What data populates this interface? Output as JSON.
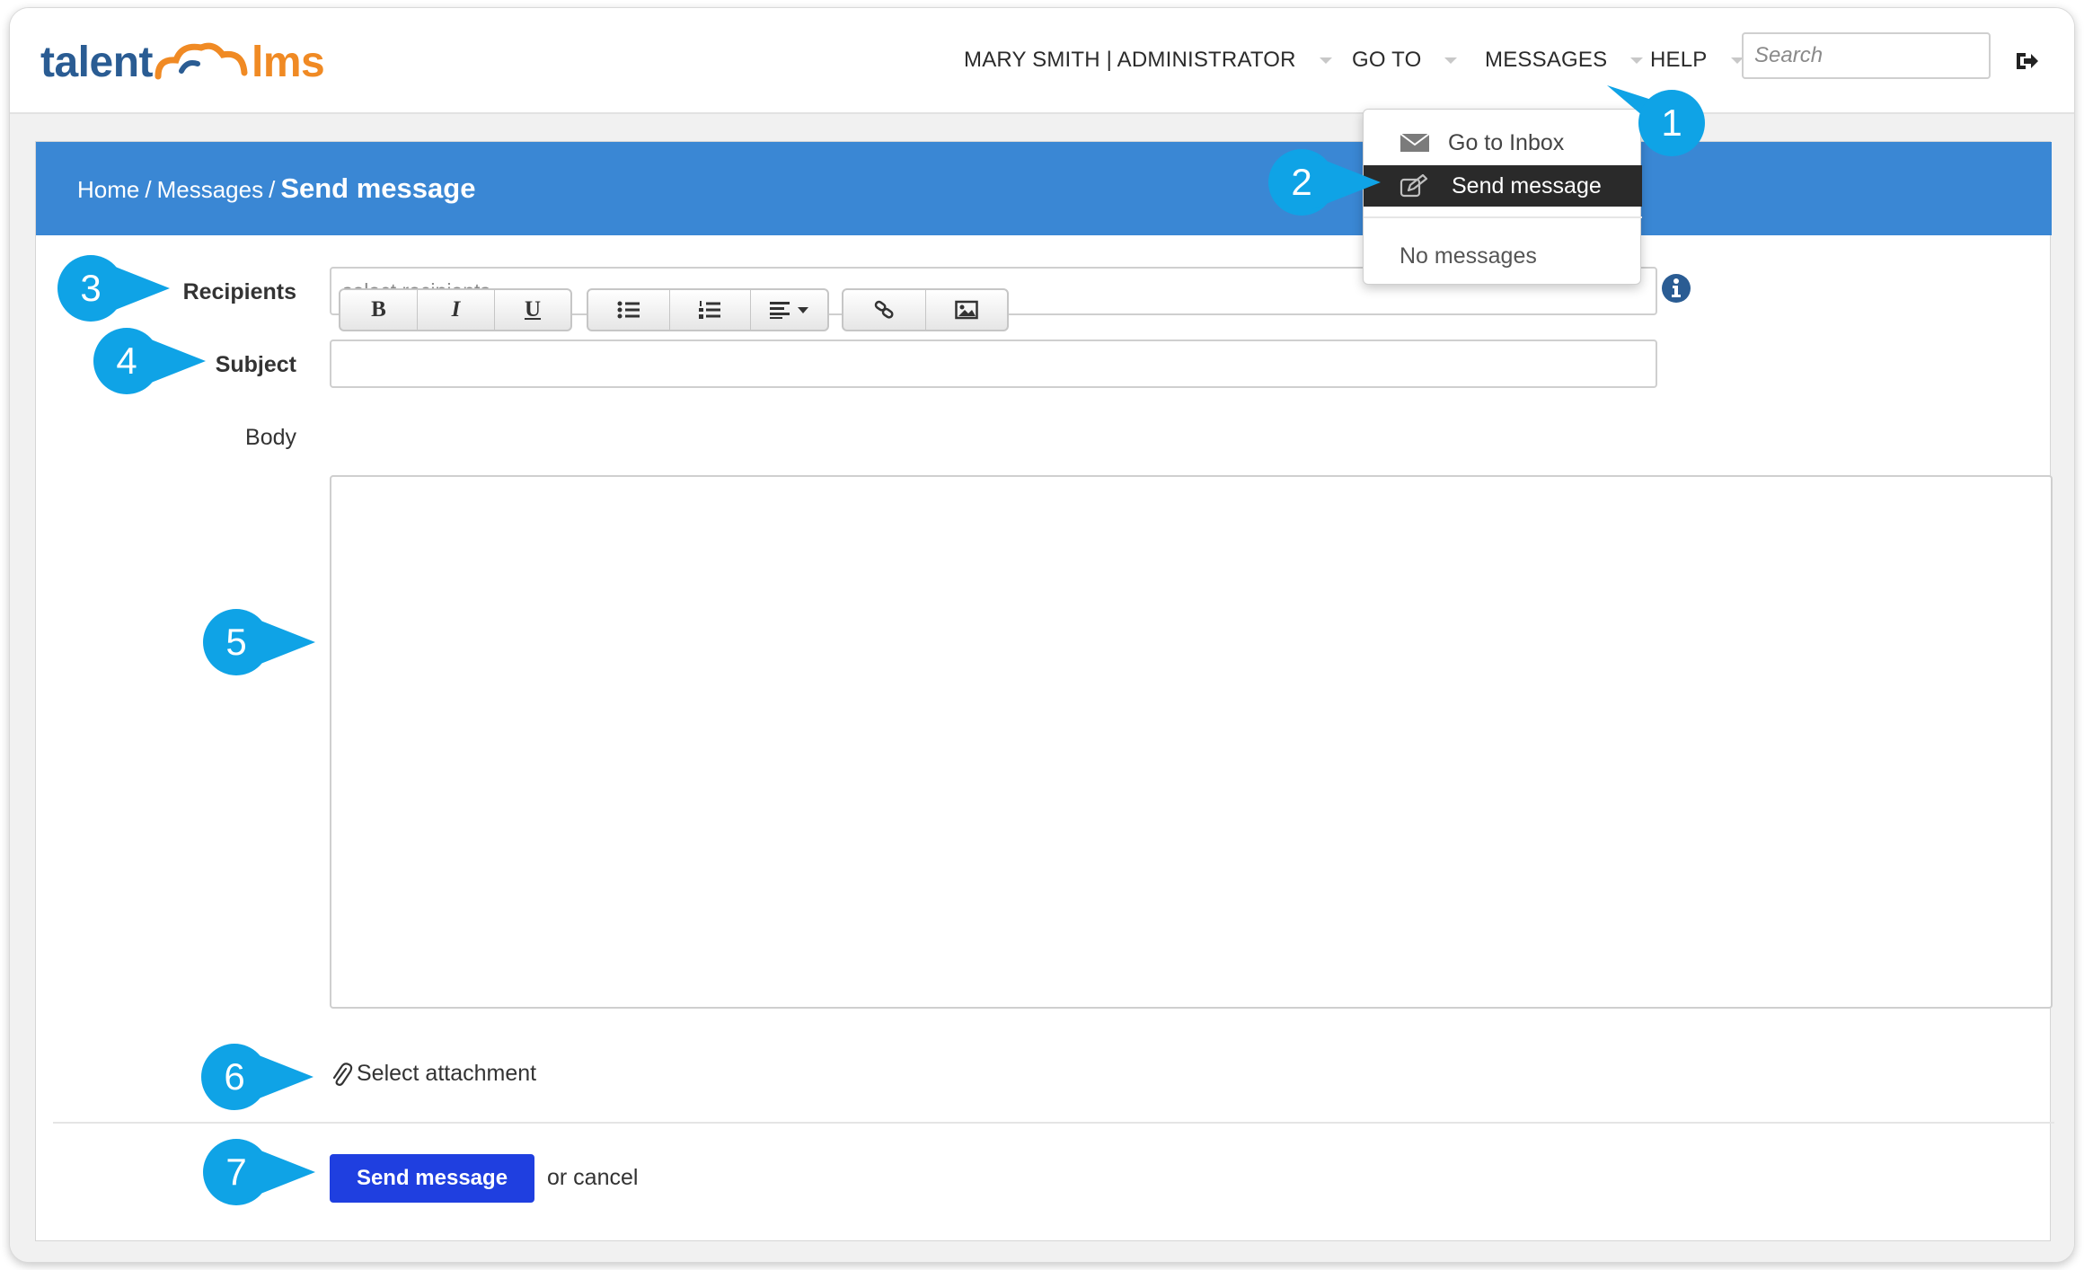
{
  "app": {
    "logo_left": "talent",
    "logo_right": "lms"
  },
  "topnav": {
    "user": "MARY SMITH | ADMINISTRATOR",
    "goto": "GO TO",
    "messages": "MESSAGES",
    "help": "HELP",
    "search_placeholder": "Search"
  },
  "messages_menu": {
    "inbox": "Go to Inbox",
    "send": "Send message",
    "empty": "No messages"
  },
  "breadcrumb": {
    "home": "Home",
    "sep": "/",
    "messages": "Messages",
    "current": "Send message"
  },
  "form": {
    "recipients_label": "Recipients",
    "recipients_placeholder": "select recipients",
    "subject_label": "Subject",
    "subject_value": "",
    "body_label": "Body",
    "attachment_label": "Select attachment",
    "submit_label": "Send message",
    "cancel_label": "or cancel"
  },
  "toolbar": {
    "bold": "B",
    "italic": "I",
    "underline": "U",
    "icons": [
      "bold-icon",
      "italic-icon",
      "underline-icon",
      "bulleted-list-icon",
      "numbered-list-icon",
      "align-dropdown-icon",
      "link-icon",
      "image-icon"
    ]
  },
  "callouts": [
    "1",
    "2",
    "3",
    "4",
    "5",
    "6",
    "7"
  ],
  "colors": {
    "header_blue": "#3a87d4",
    "button_blue": "#1f3fe0",
    "callout_blue": "#0fa3e6",
    "logo_blue": "#2a5c93",
    "logo_orange": "#f08a24"
  }
}
